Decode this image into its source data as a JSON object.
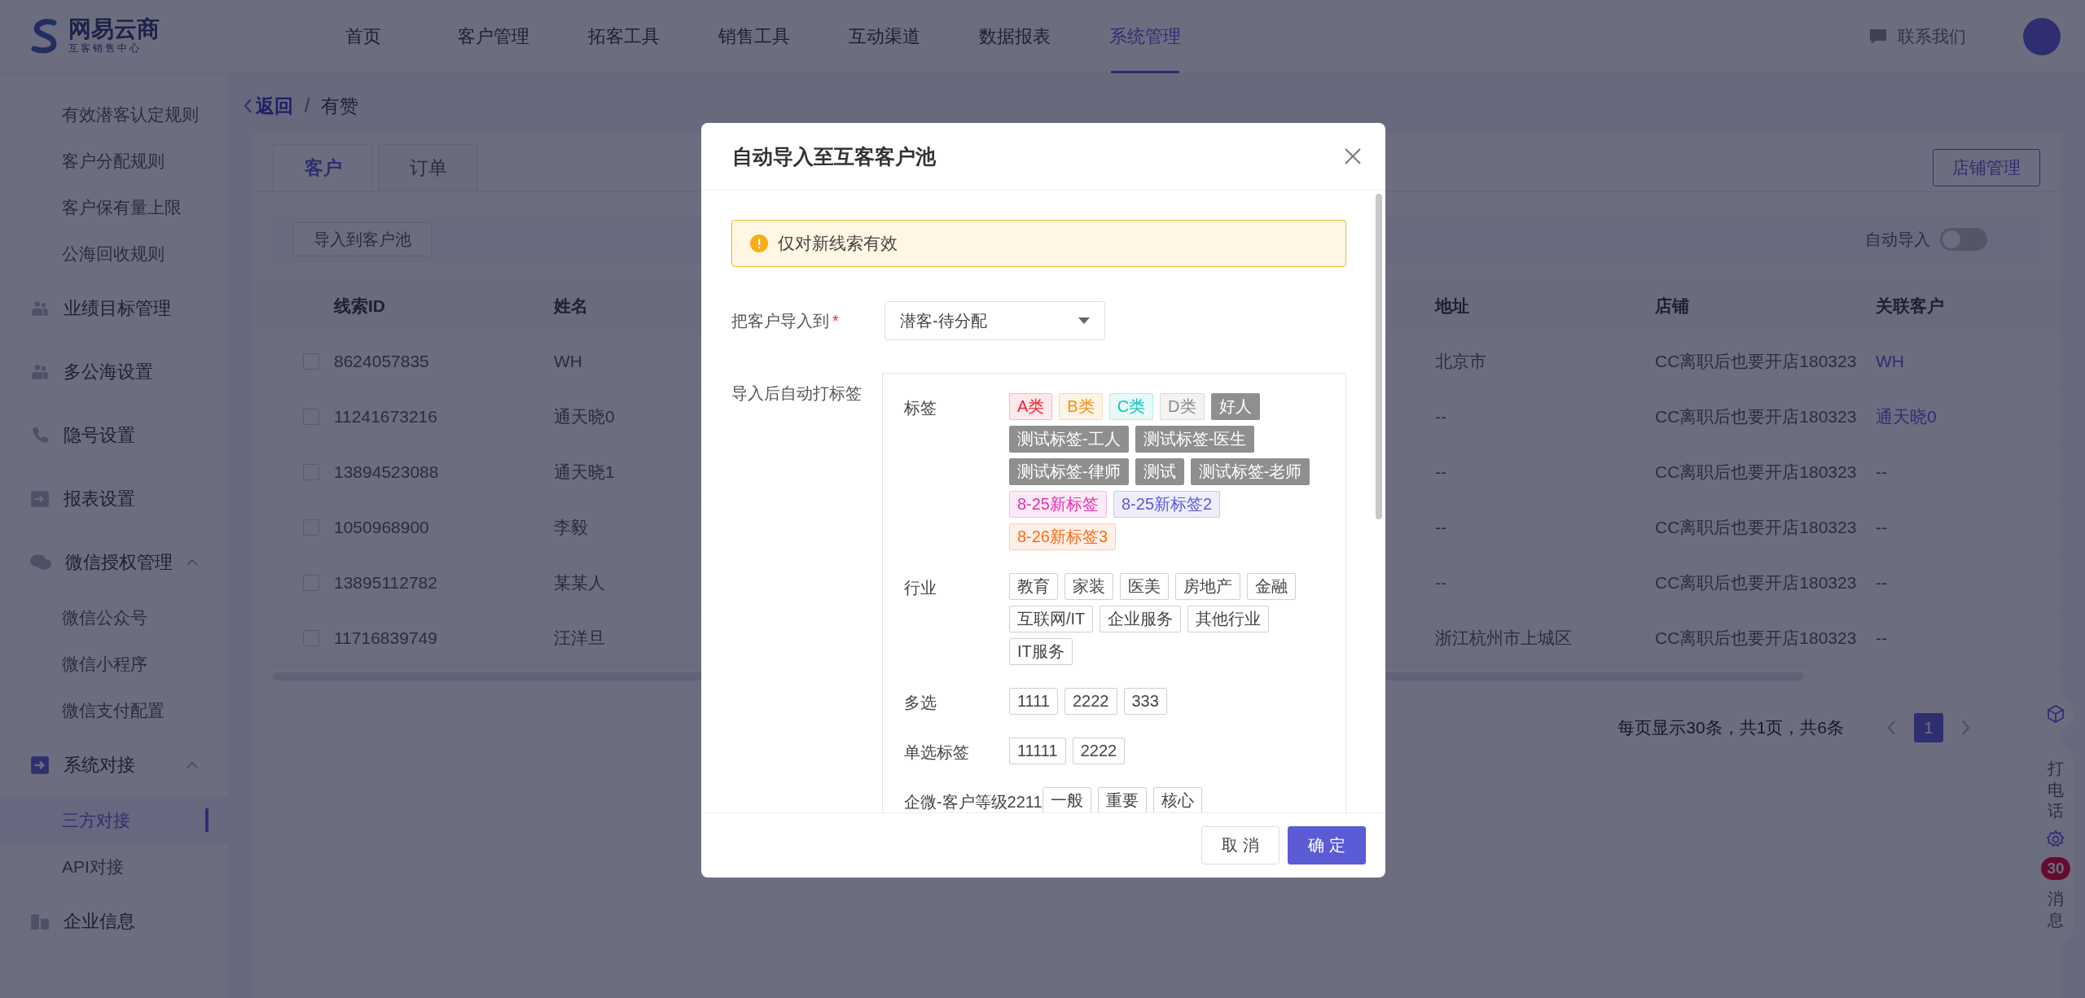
{
  "header": {
    "logo_name": "网易云商",
    "logo_subtitle": "互客销售中心",
    "nav": [
      {
        "label": "首页",
        "selected": false
      },
      {
        "label": "客户管理",
        "selected": false
      },
      {
        "label": "拓客工具",
        "selected": false
      },
      {
        "label": "销售工具",
        "selected": false
      },
      {
        "label": "互动渠道",
        "selected": false
      },
      {
        "label": "数据报表",
        "selected": false
      },
      {
        "label": "系统管理",
        "selected": true
      }
    ],
    "contact": "联系我们"
  },
  "sidebar": {
    "items": [
      {
        "label": "有效潜客认定规则",
        "kind": "sub",
        "selected": false
      },
      {
        "label": "客户分配规则",
        "kind": "sub",
        "selected": false
      },
      {
        "label": "客户保有量上限",
        "kind": "sub",
        "selected": false
      },
      {
        "label": "公海回收规则",
        "kind": "sub",
        "selected": false
      },
      {
        "label": "业绩目标管理",
        "kind": "group"
      },
      {
        "label": "多公海设置",
        "kind": "group"
      },
      {
        "label": "隐号设置",
        "kind": "group"
      },
      {
        "label": "报表设置",
        "kind": "group"
      },
      {
        "label": "微信授权管理",
        "kind": "group",
        "expanded": true,
        "children": [
          {
            "label": "微信公众号",
            "selected": false
          },
          {
            "label": "微信小程序",
            "selected": false
          },
          {
            "label": "微信支付配置",
            "selected": false
          }
        ]
      },
      {
        "label": "系统对接",
        "kind": "group",
        "expanded": true,
        "children": [
          {
            "label": "三方对接",
            "selected": true
          },
          {
            "label": "API对接",
            "selected": false
          }
        ]
      },
      {
        "label": "企业信息",
        "kind": "group"
      }
    ]
  },
  "breadcrumb": {
    "back": "返回",
    "separator": "/",
    "current": "有赞"
  },
  "tabs": [
    {
      "label": "客户",
      "selected": true
    },
    {
      "label": "订单",
      "selected": false
    }
  ],
  "store_button": "店铺管理",
  "toolbar": {
    "import_button": "导入到客户池",
    "auto_import": {
      "label": "自动导入",
      "on": false
    }
  },
  "table": {
    "columns": [
      "线索ID",
      "姓名",
      "地址",
      "店铺",
      "关联客户"
    ],
    "rows": [
      {
        "checked": false,
        "link": true,
        "cells": [
          "8624057835",
          "WH",
          "北京市",
          "CC离职后也要开店180323",
          "WH"
        ]
      },
      {
        "checked": false,
        "link": true,
        "cells": [
          "11241673216",
          "通天晓0",
          "--",
          "CC离职后也要开店180323",
          "通天晓0"
        ]
      },
      {
        "checked": false,
        "link": false,
        "cells": [
          "13894523088",
          "通天晓1",
          "--",
          "CC离职后也要开店180323",
          "--"
        ]
      },
      {
        "checked": false,
        "link": false,
        "cells": [
          "1050968900",
          "李毅",
          "--",
          "CC离职后也要开店180323",
          "--"
        ]
      },
      {
        "checked": false,
        "link": false,
        "cells": [
          "13895112782",
          "某某人",
          "--",
          "CC离职后也要开店180323",
          "--"
        ]
      },
      {
        "checked": false,
        "link": false,
        "cells": [
          "11716839749",
          "汪洋旦",
          "浙江杭州市上城区",
          "CC离职后也要开店180323",
          "--"
        ]
      }
    ]
  },
  "pagination": {
    "summary": "每页显示30条，共1页，共6条",
    "pages": [
      {
        "label": "1",
        "selected": true
      }
    ]
  },
  "float_tools": {
    "call": "打电话",
    "badge": "30",
    "messages": "消息"
  },
  "modal": {
    "title": "自动导入至互客客户池",
    "notice": "仅对新线索有效",
    "target": {
      "label": "把客户导入到",
      "required": true,
      "required_mark": "*",
      "value": "潜客-待分配"
    },
    "tag_label": "导入后自动打标签",
    "tag_groups": [
      {
        "name": "标签",
        "tags": [
          {
            "label": "A类",
            "kind": "colored",
            "color": "#f5222d"
          },
          {
            "label": "B类",
            "kind": "colored",
            "color": "#fa8c16"
          },
          {
            "label": "C类",
            "kind": "colored",
            "color": "#13c2c2"
          },
          {
            "label": "D类",
            "kind": "colored",
            "color": "#8c8c8c"
          },
          {
            "label": "好人",
            "kind": "muted"
          },
          {
            "label": "测试标签-工人",
            "kind": "muted"
          },
          {
            "label": "测试标签-医生",
            "kind": "muted"
          },
          {
            "label": "测试标签-律师",
            "kind": "muted"
          },
          {
            "label": "测试",
            "kind": "muted"
          },
          {
            "label": "测试标签-老师",
            "kind": "muted"
          },
          {
            "label": "8-25新标签",
            "kind": "colored",
            "color": "#eb2fae"
          },
          {
            "label": "8-25新标签2",
            "kind": "colored",
            "color": "#5b5bd6"
          },
          {
            "label": "8-26新标签3",
            "kind": "colored",
            "color": "#fa6c16"
          }
        ]
      },
      {
        "name": "行业",
        "tags": [
          {
            "label": "教育",
            "kind": "plain"
          },
          {
            "label": "家装",
            "kind": "plain"
          },
          {
            "label": "医美",
            "kind": "plain"
          },
          {
            "label": "房地产",
            "kind": "plain"
          },
          {
            "label": "金融",
            "kind": "plain"
          },
          {
            "label": "互联网/IT",
            "kind": "plain"
          },
          {
            "label": "企业服务",
            "kind": "plain"
          },
          {
            "label": "其他行业",
            "kind": "plain"
          },
          {
            "label": "IT服务",
            "kind": "plain"
          }
        ]
      },
      {
        "name": "多选",
        "tags": [
          {
            "label": "1111",
            "kind": "plain"
          },
          {
            "label": "2222",
            "kind": "plain"
          },
          {
            "label": "333",
            "kind": "plain"
          }
        ]
      },
      {
        "name": "单选标签",
        "tags": [
          {
            "label": "11111",
            "kind": "plain"
          },
          {
            "label": "2222",
            "kind": "plain"
          }
        ]
      },
      {
        "name": "企微-客户等级2211",
        "tags": [
          {
            "label": "一般",
            "kind": "plain"
          },
          {
            "label": "重要",
            "kind": "plain"
          },
          {
            "label": "核心",
            "kind": "plain"
          }
        ]
      }
    ],
    "buttons": {
      "cancel": "取 消",
      "ok": "确 定"
    }
  }
}
